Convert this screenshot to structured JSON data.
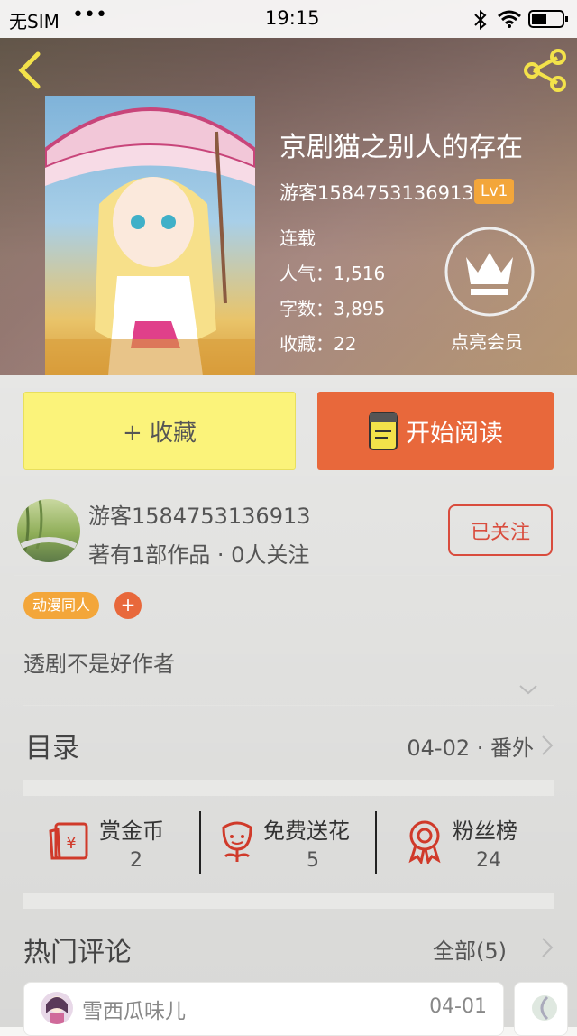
{
  "status_bar": {
    "carrier": "无SIM",
    "signal": "•••",
    "time": "19:15"
  },
  "book": {
    "title": "京剧猫之别人的存在",
    "author": "游客1584753136913",
    "level": "Lv1",
    "status": "连载",
    "popularity": "人气：1,516",
    "word_count": "字数：3,895",
    "favorites": "收藏：22",
    "member_label": "点亮会员"
  },
  "actions": {
    "favorite": "+ 收藏",
    "read": "开始阅读"
  },
  "author_info": {
    "name": "游客1584753136913",
    "summary": "著有1部作品 · 0人关注",
    "follow": "已关注"
  },
  "tags": [
    {
      "label": "动漫同人"
    }
  ],
  "tag_add": "+",
  "description": "透剧不是好作者",
  "catalog": {
    "label": "目录",
    "latest": "04-02 · 番外"
  },
  "stats": [
    {
      "label": "赏金币",
      "value": "2"
    },
    {
      "label": "免费送花",
      "value": "5"
    },
    {
      "label": "粉丝榜",
      "value": "24"
    }
  ],
  "comments": {
    "title": "热门评论",
    "all": "全部(5)",
    "items": [
      {
        "user": "雪西瓜味儿",
        "date": "04-01"
      }
    ]
  },
  "colors": {
    "accent": "#e8683b",
    "favorite_bg": "#fbf37a",
    "tag": "#f3a63a",
    "follow": "#d94c3d"
  }
}
